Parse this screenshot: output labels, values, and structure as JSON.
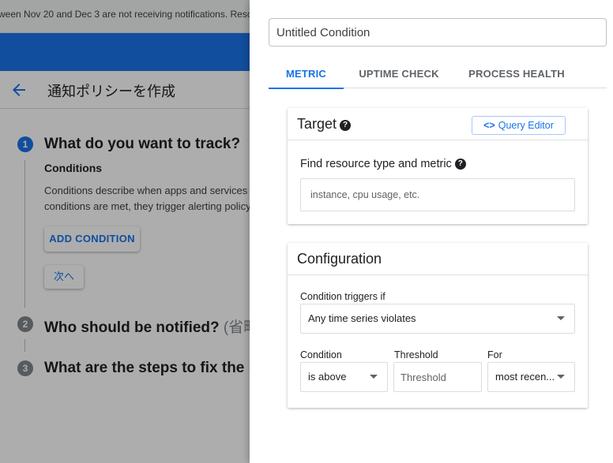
{
  "background": {
    "banner_text": "ween Nov 20 and Dec 3 are not receiving notifications. Resol",
    "page_title": "通知ポリシーを作成",
    "steps": [
      {
        "number": "1",
        "title": "What do you want to track?",
        "title_suffix": ""
      },
      {
        "number": "2",
        "title": "Who should be notified?",
        "title_suffix": " (省略"
      },
      {
        "number": "3",
        "title": "What are the steps to fix the i",
        "title_suffix": ""
      }
    ],
    "conditions_heading": "Conditions",
    "conditions_desc_line1": "Conditions describe when apps and services",
    "conditions_desc_line2": "conditions are met, they trigger alerting policy",
    "add_condition_label": "ADD CONDITION",
    "next_label": "次へ"
  },
  "panel": {
    "condition_name": "Untitled Condition",
    "tabs": [
      {
        "label": "METRIC",
        "active": true
      },
      {
        "label": "UPTIME CHECK",
        "active": false
      },
      {
        "label": "PROCESS HEALTH",
        "active": false
      }
    ],
    "target": {
      "title": "Target",
      "help_glyph": "?",
      "query_editor_icon": "<>",
      "query_editor_label": "Query Editor",
      "find_label": "Find resource type and metric",
      "search_placeholder": "instance, cpu usage, etc."
    },
    "configuration": {
      "title": "Configuration",
      "triggers_label": "Condition triggers if",
      "triggers_value": "Any time series violates",
      "condition_label": "Condition",
      "condition_value": "is above",
      "threshold_label": "Threshold",
      "threshold_placeholder": "Threshold",
      "for_label": "For",
      "for_value": "most recen..."
    }
  },
  "colors": {
    "accent": "#1a73e8",
    "scrim": "rgba(0,0,0,0.32)"
  }
}
